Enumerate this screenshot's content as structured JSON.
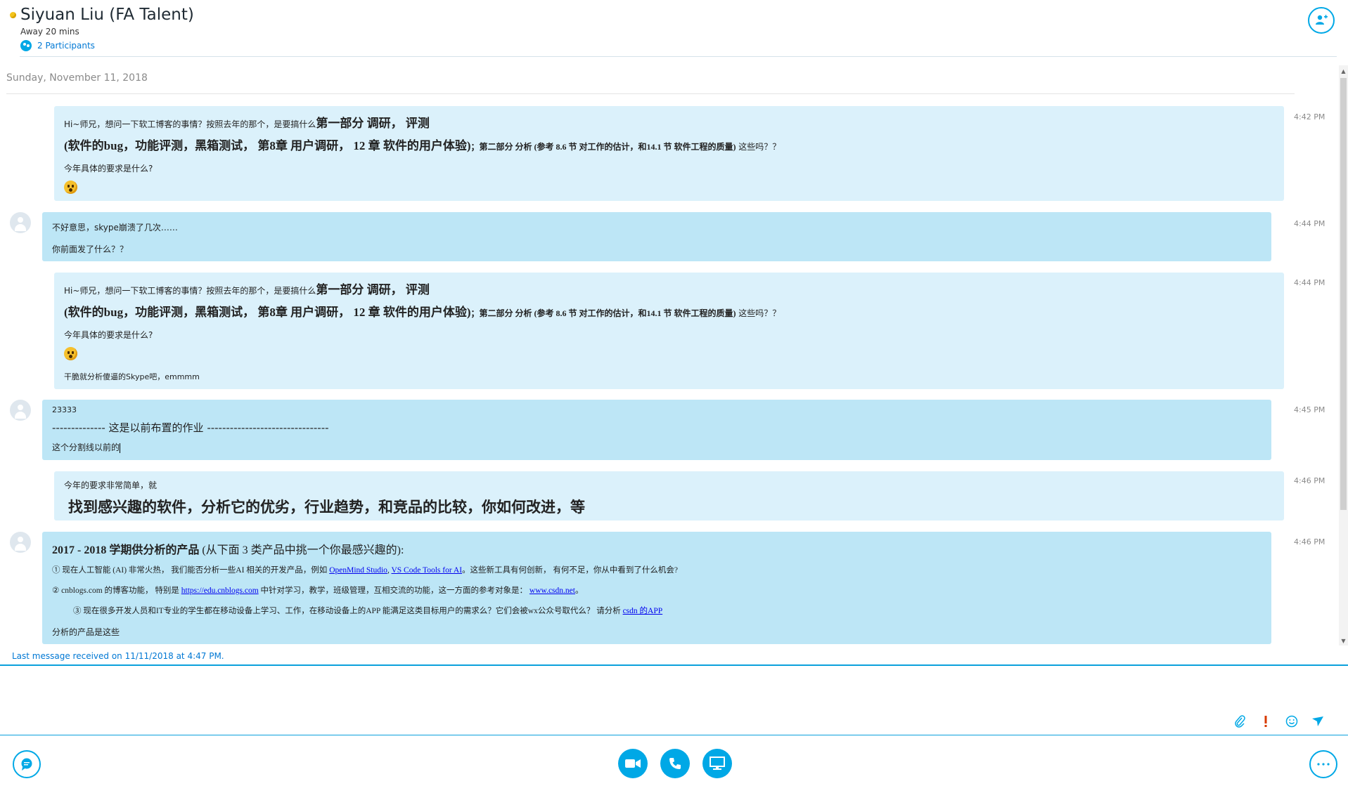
{
  "header": {
    "contact_name": "Siyuan Liu (FA Talent)",
    "presence": "Away 20 mins",
    "participants": "2 Participants"
  },
  "chat": {
    "date": "Sunday, November 11, 2018",
    "messages": [
      {
        "time": "4:42 PM",
        "line1_small": "Hi~师兄，想问一下软工博客的事情？按照去年的那个，是要搞什么",
        "line1_bold": "第一部分  调研，  评测",
        "line2_bold": "(软件的bug，功能评测，黑箱测试，  第8章 用户调研，  12 章 软件的用户体验)",
        "line2_mid": "；第二部分 分析  (参考 8.6 节 对工作的估计，和14.1 节 软件工程的质量)",
        "line2_tail": " 这些吗？？",
        "line3": "今年具体的要求是什么?"
      },
      {
        "time": "4:44 PM",
        "line1": "不好意思，skype崩溃了几次……",
        "line2": "你前面发了什么？？"
      },
      {
        "time": "4:44 PM",
        "line1_small": "Hi~师兄，想问一下软工博客的事情？按照去年的那个，是要搞什么",
        "line1_bold": "第一部分  调研，  评测",
        "line2_bold": "(软件的bug，功能评测，黑箱测试，  第8章 用户调研，  12 章 软件的用户体验)",
        "line2_mid": "；第二部分 分析  (参考 8.6 节 对工作的估计，和14.1 节 软件工程的质量)",
        "line2_tail": " 这些吗？？",
        "line3": "今年具体的要求是什么?",
        "line4": "干脆就分析傻逼的Skype吧，emmmm"
      },
      {
        "time": "4:45 PM",
        "line1": "23333",
        "line2": "--------------  这是以前布置的作业  --------------------------------",
        "line3": "这个分割线以前的"
      },
      {
        "time": "4:46 PM",
        "line1": "今年的要求非常简单，就",
        "line2": "找到感兴趣的软件，分析它的优劣，行业趋势，和竞品的比较，你如何改进，等"
      },
      {
        "time": "4:46 PM",
        "title_bold": "2017 - 2018 学期供分析的产品",
        "title_rest": " (从下面 3 类产品中挑一个你最感兴趣的):",
        "item1_pre": "①  现在人工智能  (AI)   非常火热，  我们能否分析一些AI 相关的开发产品，例如 ",
        "item1_link1": "OpenMind Studio",
        "item1_sep": ",  ",
        "item1_link2": "VS Code Tools for AI",
        "item1_post": "。这些新工具有何创新，  有何不足，你从中看到了什么机会?",
        "item2_pre": "②  cnblogs.com 的博客功能，   特别是 ",
        "item2_link1": "https://edu.cnblogs.com",
        "item2_mid": " 中针对学习，教学，班级管理，互相交流的功能，这一方面的参考对象是：  ",
        "item2_link2": "www.csdn.net",
        "item2_post": "。",
        "item3_pre": "③  现在很多开发人员和IT专业的学生都在移动设备上学习、工作，在移动设备上的APP 能满足这类目标用户的需求么？它们会被wx公众号取代么？  请分析 ",
        "item3_link": "csdn 的APP",
        "footer": "分析的产品是这些"
      }
    ]
  },
  "status": {
    "last_message": "Last message received on 11/11/2018 at 4:47 PM."
  },
  "icons": {
    "add_person": "add-person-icon",
    "attach": "paperclip-icon",
    "important": "exclamation-icon",
    "emoticon": "smiley-icon",
    "send": "send-icon",
    "chat": "chat-icon",
    "video": "video-camera-icon",
    "call": "phone-icon",
    "screen_share": "monitor-icon",
    "more": "more-icon"
  },
  "colors": {
    "accent": "#00a8e6",
    "own_bubble": "#dbf1fb",
    "their_bubble": "#bde6f6",
    "link": "#0000ee",
    "presence_away": "#f3c41b"
  }
}
